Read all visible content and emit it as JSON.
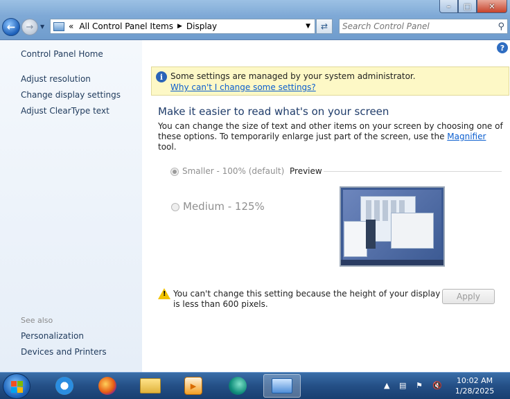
{
  "window": {
    "controls": {
      "minimize": "–",
      "maximize": "□",
      "close": "✕"
    },
    "breadcrumb": {
      "prefix": "«",
      "items": [
        "All Control Panel Items",
        "Display"
      ]
    },
    "search_placeholder": "Search Control Panel"
  },
  "sidebar": {
    "home": "Control Panel Home",
    "links": [
      "Adjust resolution",
      "Change display settings",
      "Adjust ClearType text"
    ],
    "see_also_label": "See also",
    "see_also": [
      "Personalization",
      "Devices and Printers"
    ]
  },
  "main": {
    "info_message": "Some settings are managed by your system administrator.",
    "info_link": "Why can't I change some settings?",
    "heading": "Make it easier to read what's on your screen",
    "description_before": "You can change the size of text and other items on your screen by choosing one of these options. To temporarily enlarge just part of the screen, use the ",
    "description_link": "Magnifier",
    "description_after": " tool.",
    "options": [
      {
        "label": "Smaller - 100% (default)",
        "selected": true
      },
      {
        "label": "Medium - 125%",
        "selected": false
      }
    ],
    "preview_label": "Preview",
    "warning": "You can't change this setting because the height of your display is less than 600 pixels.",
    "apply_button": "Apply"
  },
  "taskbar": {
    "apps": [
      "internet-explorer",
      "firefox",
      "file-explorer",
      "media-player",
      "edge",
      "control-panel"
    ],
    "active_app": "control-panel",
    "time": "10:02 AM",
    "date": "1/28/2025"
  }
}
